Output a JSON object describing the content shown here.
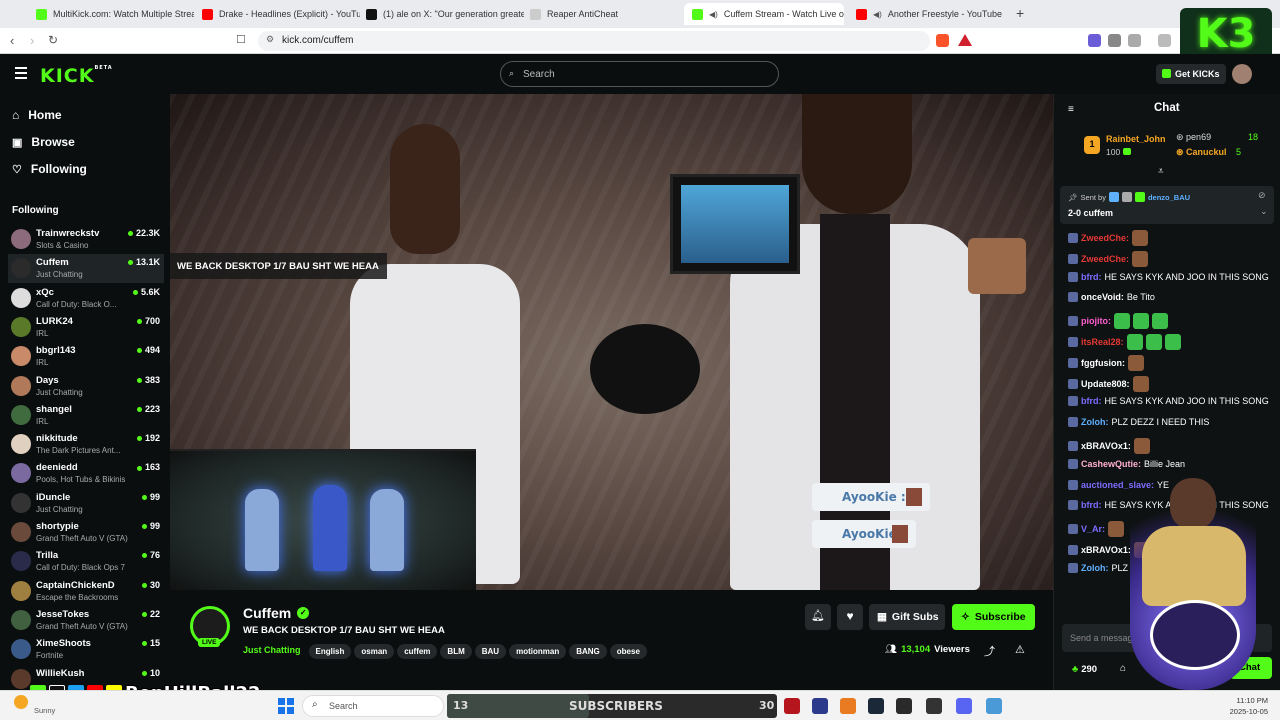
{
  "browser": {
    "tabs": [
      {
        "title": "MultiKick.com: Watch Multiple Strea",
        "color": "#53fc18"
      },
      {
        "title": "Drake - Headlines (Explicit) - YouTub",
        "color": "#ff0000"
      },
      {
        "title": "(1) ale on X: \"Our generation greater",
        "color": "#111111"
      },
      {
        "title": "Reaper AntiCheat",
        "color": "#cccccc"
      },
      {
        "title": "Cuffem Stream - Watch Live o",
        "color": "#53fc18"
      },
      {
        "title": "Another Freestyle - YouTube",
        "color": "#ff0000"
      }
    ],
    "new_tab": "+",
    "url": "kick.com/cuffem"
  },
  "header": {
    "logo": "KICK",
    "logo_sup": "BETA",
    "search_placeholder": "Search",
    "get_kicks": "Get KICKs"
  },
  "sidebar": {
    "nav": [
      {
        "label": "Home",
        "icon": "home-icon"
      },
      {
        "label": "Browse",
        "icon": "browse-icon"
      },
      {
        "label": "Following",
        "icon": "heart-icon"
      }
    ],
    "following_heading": "Following",
    "channels": [
      {
        "name": "Trainwreckstv",
        "category": "Slots & Casino",
        "viewers": "22.3K",
        "color": "#8c6b7c"
      },
      {
        "name": "Cuffem",
        "category": "Just Chatting",
        "viewers": "13.1K",
        "color": "#2b2b2b"
      },
      {
        "name": "xQc",
        "category": "Call of Duty: Black O...",
        "viewers": "5.6K",
        "color": "#dddddd"
      },
      {
        "name": "LURK24",
        "category": "IRL",
        "viewers": "700",
        "color": "#5a7a2a"
      },
      {
        "name": "bbgrl143",
        "category": "IRL",
        "viewers": "494",
        "color": "#c98a6a"
      },
      {
        "name": "Days",
        "category": "Just Chatting",
        "viewers": "383",
        "color": "#b07a5a"
      },
      {
        "name": "shangel",
        "category": "IRL",
        "viewers": "223",
        "color": "#3f6b3f"
      },
      {
        "name": "nikkitude",
        "category": "The Dark Pictures Ant...",
        "viewers": "192",
        "color": "#e0d0c0"
      },
      {
        "name": "deeniedd",
        "category": "Pools, Hot Tubs & Bikinis",
        "viewers": "163",
        "color": "#7a6aa0"
      },
      {
        "name": "iDuncle",
        "category": "Just Chatting",
        "viewers": "99",
        "color": "#333333"
      },
      {
        "name": "shortypie",
        "category": "Grand Theft Auto V (GTA)",
        "viewers": "99",
        "color": "#6a4a3a"
      },
      {
        "name": "Trilla",
        "category": "Call of Duty: Black Ops 7",
        "viewers": "76",
        "color": "#2a2a4a"
      },
      {
        "name": "CaptainChickenD",
        "category": "Escape the Backrooms",
        "viewers": "30",
        "color": "#a08040"
      },
      {
        "name": "JesseTokes",
        "category": "Grand Theft Auto V (GTA)",
        "viewers": "22",
        "color": "#406040"
      },
      {
        "name": "XimeShoots",
        "category": "Fortnite",
        "viewers": "15",
        "color": "#3a5a8a"
      },
      {
        "name": "WillieKush",
        "category": "",
        "viewers": "10",
        "color": "#5a3a2a"
      }
    ]
  },
  "video": {
    "title_overlay": "WE BACK DESKTOP 1/7 BAU SHT WE HEAA",
    "alerts": [
      "AyooKie :",
      "AyooKie :"
    ]
  },
  "stream": {
    "channel_name": "Cuffem",
    "live_badge": "LIVE",
    "title": "WE BACK DESKTOP 1/7 BAU SHT WE HEAA",
    "category": "Just Chatting",
    "tags": [
      "English",
      "osman",
      "cuffem",
      "BLM",
      "BAU",
      "motionman",
      "BANG",
      "obese"
    ],
    "gift_subs": "Gift Subs",
    "subscribe": "Subscribe",
    "viewers": "13,104",
    "viewers_label": "Viewers"
  },
  "chat": {
    "title": "Chat",
    "leaderboard": [
      {
        "rank": "1",
        "name": "Rainbet_John",
        "value": "100"
      },
      {
        "name": "pen69",
        "value": "18"
      },
      {
        "name": "Canuckul",
        "value": "5"
      }
    ],
    "pinned": {
      "sent_by_label": "Sent by",
      "sender": "denzo_BAU",
      "text": "2-0 cuffem"
    },
    "messages": [
      {
        "user": "ZweedChe:",
        "color": "#e53935",
        "text": ""
      },
      {
        "user": "ZweedChe:",
        "color": "#e53935",
        "text": ""
      },
      {
        "user": "bfrd:",
        "color": "#7c6cff",
        "text": "HE SAYS KYK AND JOO IN THIS SONG"
      },
      {
        "user": "onceVoid:",
        "color": "#ffffff",
        "text": "Be Tito"
      },
      {
        "user": "piojito:",
        "color": "#ff5fd2",
        "text": ""
      },
      {
        "user": "itsReal28:",
        "color": "#e53935",
        "text": ""
      },
      {
        "user": "fggfusion:",
        "color": "#ffffff",
        "text": ""
      },
      {
        "user": "Update808:",
        "color": "#ffffff",
        "text": ""
      },
      {
        "user": "bfrd:",
        "color": "#7c6cff",
        "text": "HE SAYS KYK AND JOO IN THIS SONG"
      },
      {
        "user": "Zoloh:",
        "color": "#5fb0ff",
        "text": "PLZ DEZZ I NEED THIS"
      },
      {
        "user": "xBRAVOx1:",
        "color": "#ffffff",
        "text": ""
      },
      {
        "user": "CashewQutie:",
        "color": "#ffb0d0",
        "text": "Billie Jean"
      },
      {
        "user": "auctioned_slave:",
        "color": "#7c6cff",
        "text": "YE"
      },
      {
        "user": "bfrd:",
        "color": "#7c6cff",
        "text": "HE SAYS KYK AND JOO IN THIS SONG"
      },
      {
        "user": "V_Ar:",
        "color": "#7c6cff",
        "text": ""
      },
      {
        "user": "xBRAVOx1:",
        "color": "#ffffff",
        "text": ""
      },
      {
        "user": "Zoloh:",
        "color": "#5fb0ff",
        "text": "PLZ"
      }
    ],
    "input_placeholder": "Send a message",
    "points": "290",
    "send_label": "Chat"
  },
  "overlay": {
    "streamer_tag": "BenHillBall22",
    "subscribers_count": "13",
    "subscribers_label": "SUBSCRIBERS",
    "subscribers_goal": "30"
  },
  "taskbar": {
    "weather": "Sunny",
    "search": "Search",
    "time": "11:10 PM",
    "date": "2025-10-05"
  },
  "colors": {
    "accent": "#53fc18",
    "bg": "#0b0e0f"
  }
}
